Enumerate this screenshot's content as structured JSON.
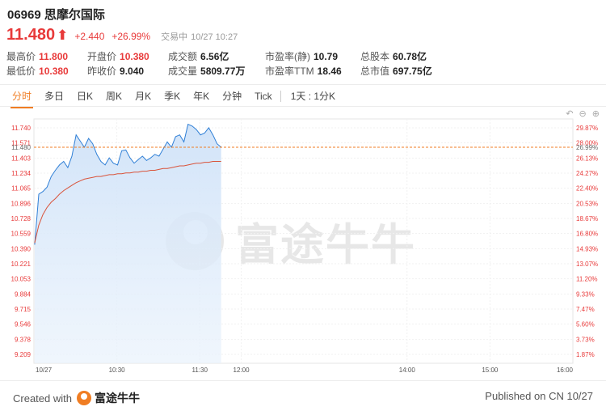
{
  "header": {
    "code": "06969",
    "name": "思摩尔国际"
  },
  "quote": {
    "price": "11.480",
    "arrow": "⬆",
    "change": "+2.440",
    "change_pct": "+26.99%",
    "status": "交易中",
    "datetime": "10/27 10:27"
  },
  "stats": [
    {
      "label": "最高价",
      "value": "11.800",
      "red": true
    },
    {
      "label": "开盘价",
      "value": "10.380",
      "red": true
    },
    {
      "label": "成交额",
      "value": "6.56亿",
      "red": false
    },
    {
      "label": "市盈率(静)",
      "value": "10.79",
      "red": false
    },
    {
      "label": "总股本",
      "value": "60.78亿",
      "red": false
    },
    {
      "label": "最低价",
      "value": "10.380",
      "red": true
    },
    {
      "label": "昨收价",
      "value": "9.040",
      "red": false
    },
    {
      "label": "成交量",
      "value": "5809.77万",
      "red": false
    },
    {
      "label": "市盈率TTM",
      "value": "18.46",
      "red": false
    },
    {
      "label": "总市值",
      "value": "697.75亿",
      "red": false
    }
  ],
  "tabs": [
    "分时",
    "多日",
    "日K",
    "周K",
    "月K",
    "季K",
    "年K",
    "分钟",
    "Tick"
  ],
  "tab_extra": "1天 : 1分K",
  "active_tab": "分时",
  "tools_icons": [
    "undo-icon",
    "zoom-out-icon",
    "zoom-in-icon"
  ],
  "watermark": "富途牛牛",
  "footer": {
    "created_prefix": "Created with",
    "brand": "富途牛牛",
    "published": "Published on CN 10/27"
  },
  "colors": {
    "up": "#e83a3a",
    "down": "#2c9b4c",
    "price_line": "#2f7fd6",
    "avg_line": "#d9533a",
    "accent": "#f07d23"
  },
  "chart_data": {
    "type": "line",
    "prev_close": 9.04,
    "current_price": 11.48,
    "current_price_label": "11.480",
    "current_pct_label": "26.99%",
    "ylim": [
      9.04,
      11.8
    ],
    "y_ticks_left": [
      "11.740",
      "11.571",
      "11.403",
      "11.234",
      "11.065",
      "10.896",
      "10.728",
      "10.559",
      "10.390",
      "10.221",
      "10.053",
      "9.884",
      "9.715",
      "9.546",
      "9.378",
      "9.209"
    ],
    "y_ticks_right": [
      "29.87%",
      "28.00%",
      "26.13%",
      "24.27%",
      "22.40%",
      "20.53%",
      "18.67%",
      "16.80%",
      "14.93%",
      "13.07%",
      "11.20%",
      "9.33%",
      "7.47%",
      "5.60%",
      "3.73%",
      "1.87%"
    ],
    "x_ticks": [
      "10/27",
      "10:30",
      "11:30",
      "12:00",
      "14:00",
      "15:00",
      "16:00"
    ],
    "minutes_total": 390,
    "x_tick_minutes": [
      0,
      60,
      120,
      150,
      270,
      330,
      390
    ],
    "series": [
      {
        "name": "",
        "values": [
          10.38,
          10.95,
          10.98,
          11.03,
          11.15,
          11.22,
          11.28,
          11.32,
          11.25,
          11.38,
          11.62,
          11.55,
          11.48,
          11.58,
          11.52,
          11.4,
          11.32,
          11.28,
          11.36,
          11.3,
          11.28,
          11.44,
          11.45,
          11.36,
          11.3,
          11.34,
          11.38,
          11.33,
          11.36,
          11.4,
          11.38,
          11.46,
          11.54,
          11.48,
          11.6,
          11.62,
          11.54,
          11.74,
          11.72,
          11.68,
          11.62,
          11.64,
          11.7,
          11.62,
          11.52,
          11.48
        ]
      },
      {
        "name": "",
        "values": [
          10.4,
          10.6,
          10.72,
          10.8,
          10.86,
          10.9,
          10.95,
          10.99,
          11.02,
          11.05,
          11.08,
          11.1,
          11.12,
          11.13,
          11.14,
          11.15,
          11.15,
          11.16,
          11.17,
          11.17,
          11.18,
          11.18,
          11.19,
          11.19,
          11.2,
          11.2,
          11.21,
          11.21,
          11.22,
          11.22,
          11.23,
          11.24,
          11.24,
          11.25,
          11.26,
          11.27,
          11.27,
          11.28,
          11.29,
          11.3,
          11.3,
          11.31,
          11.31,
          11.32,
          11.32,
          11.32
        ]
      }
    ]
  }
}
